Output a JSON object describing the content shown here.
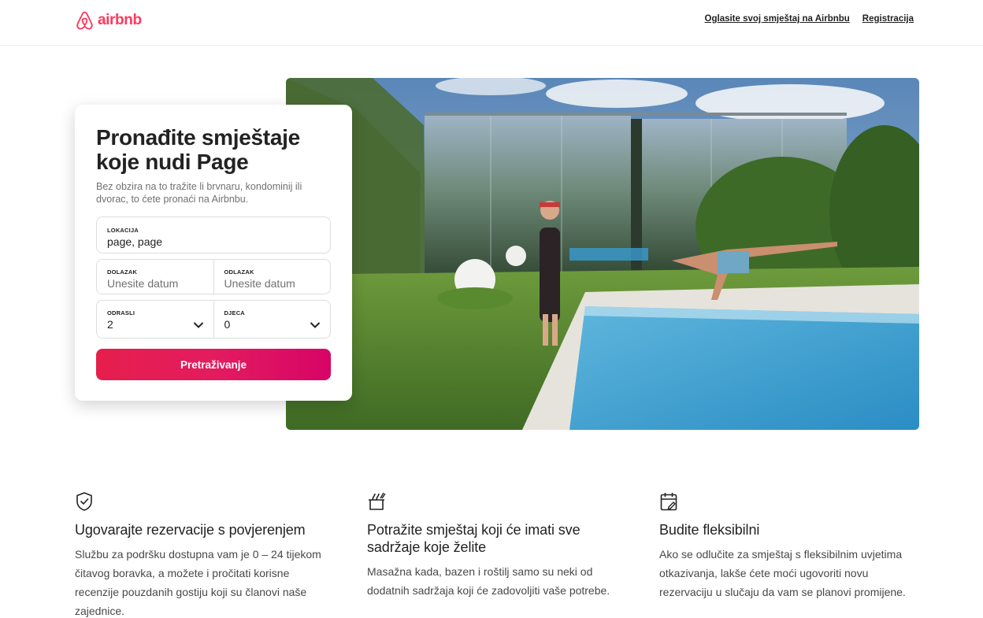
{
  "header": {
    "logo_text": "airbnb",
    "links": [
      "Oglasite svoj smještaj na Airbnbu",
      "Registracija"
    ]
  },
  "search_card": {
    "title": "Pronađite smještaje koje nudi Page",
    "subtitle": "Bez obzira na to tražite li brvnaru, kondominij ili dvorac, to ćete pronaći na Airbnbu.",
    "location": {
      "label": "LOKACIJA",
      "value": "page, page"
    },
    "checkin": {
      "label": "DOLAZAK",
      "placeholder": "Unesite datum"
    },
    "checkout": {
      "label": "ODLAZAK",
      "placeholder": "Unesite datum"
    },
    "adults": {
      "label": "ODRASLI",
      "value": "2"
    },
    "children": {
      "label": "DJECA",
      "value": "0"
    },
    "search_button": "Pretraživanje"
  },
  "features": [
    {
      "icon": "shield-check-icon",
      "title": "Ugovarajte rezervacije s povjerenjem",
      "text": "Službu za podršku dostupna vam je 0 – 24 tijekom čitavog boravka, a možete i pročitati korisne recenzije pouzdanih gostiju koji su članovi naše zajednice."
    },
    {
      "icon": "cooking-pot-icon",
      "title": "Potražite smještaj koji će imati sve sadržaje koje želite",
      "text": "Masažna kada, bazen i roštilj samo su neki od dodatnih sadržaja koji će zadovoljiti vaše potrebe."
    },
    {
      "icon": "calendar-edit-icon",
      "title": "Budite fleksibilni",
      "text": "Ako se odlučite za smještaj s fleksibilnim uvjetima otkazivanja, lakše ćete moći ugovoriti novu rezervaciju u slučaju da vam se planovi promijene."
    }
  ],
  "colors": {
    "brand": "#ff385c",
    "button_gradient_start": "#e61e4d",
    "button_gradient_end": "#d70466",
    "text": "#222222",
    "muted": "#717171"
  }
}
